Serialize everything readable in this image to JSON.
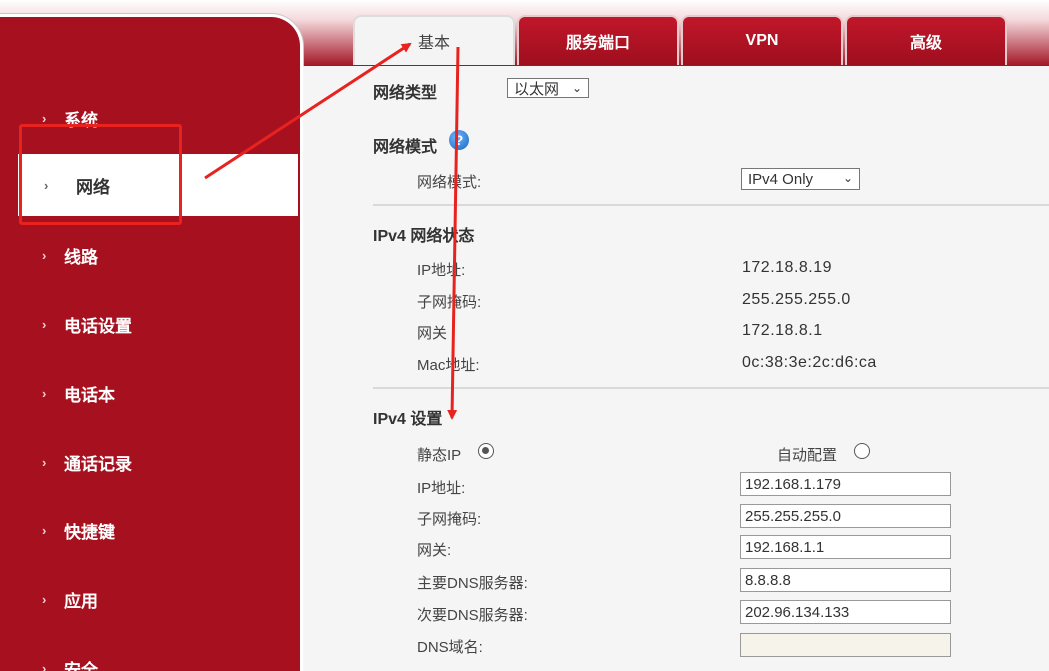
{
  "tabs": [
    {
      "label": "基本",
      "active": true
    },
    {
      "label": "服务端口",
      "active": false
    },
    {
      "label": "VPN",
      "active": false
    },
    {
      "label": "高级",
      "active": false
    }
  ],
  "sidebar": {
    "items": [
      {
        "label": "系统"
      },
      {
        "label": "网络",
        "active": true
      },
      {
        "label": "线路"
      },
      {
        "label": "电话设置"
      },
      {
        "label": "电话本"
      },
      {
        "label": "通话记录"
      },
      {
        "label": "快捷键"
      },
      {
        "label": "应用"
      },
      {
        "label": "安全"
      }
    ]
  },
  "network_type": {
    "label": "网络类型",
    "value": "以太网"
  },
  "network_mode": {
    "title": "网络模式",
    "field_label": "网络模式:",
    "value": "IPv4 Only"
  },
  "ipv4_status": {
    "title": "IPv4 网络状态",
    "rows": [
      {
        "label": "IP地址:",
        "value": "172.18.8.19"
      },
      {
        "label": "子网掩码:",
        "value": "255.255.255.0"
      },
      {
        "label": "网关",
        "value": "172.18.8.1"
      },
      {
        "label": "Mac地址:",
        "value": "0c:38:3e:2c:d6:ca"
      }
    ]
  },
  "ipv4_settings": {
    "title": "IPv4 设置",
    "static_ip_label": "静态IP",
    "auto_config_label": "自动配置",
    "selected": "static",
    "fields": [
      {
        "label": "IP地址:",
        "value": "192.168.1.179"
      },
      {
        "label": "子网掩码:",
        "value": "255.255.255.0"
      },
      {
        "label": "网关:",
        "value": "192.168.1.1"
      },
      {
        "label": "主要DNS服务器:",
        "value": "8.8.8.8"
      },
      {
        "label": "次要DNS服务器:",
        "value": "202.96.134.133"
      },
      {
        "label": "DNS域名:",
        "value": ""
      }
    ]
  },
  "colors": {
    "brand": "#a7111f",
    "annotation": "#e8231f"
  },
  "icons": {
    "help": "help-icon",
    "caret": "chevron-down-icon",
    "bullet": "chevron-right-icon"
  }
}
